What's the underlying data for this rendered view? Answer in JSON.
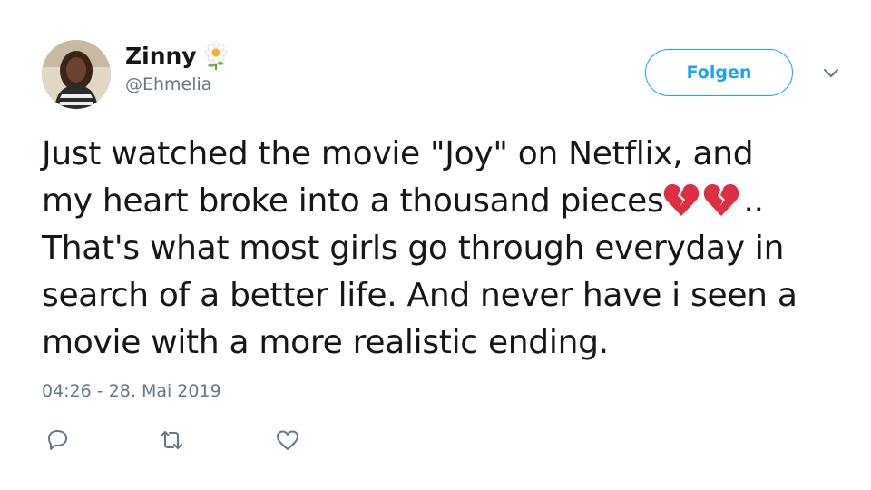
{
  "user": {
    "display_name": "Zinny",
    "name_emoji": "flower-icon",
    "handle": "@Ehmelia"
  },
  "follow_label": "Folgen",
  "tweet": {
    "line1": "Just watched the movie \"Joy\" on Netflix, and",
    "line2_before": "my heart broke into a thousand pieces",
    "line2_after": "..",
    "line3": "That's what most girls go through everyday in",
    "line4": "search of a better life. And never have i seen a",
    "line5": "movie with a more realistic ending.",
    "emojis": [
      "broken-heart-icon",
      "broken-heart-icon"
    ]
  },
  "timestamp": "04:26 - 28. Mai 2019",
  "actions": [
    "reply-icon",
    "retweet-icon",
    "like-icon"
  ],
  "colors": {
    "accent": "#1da1f2",
    "text": "#14171a",
    "muted": "#657786",
    "heart_red": "#dd2e44"
  }
}
